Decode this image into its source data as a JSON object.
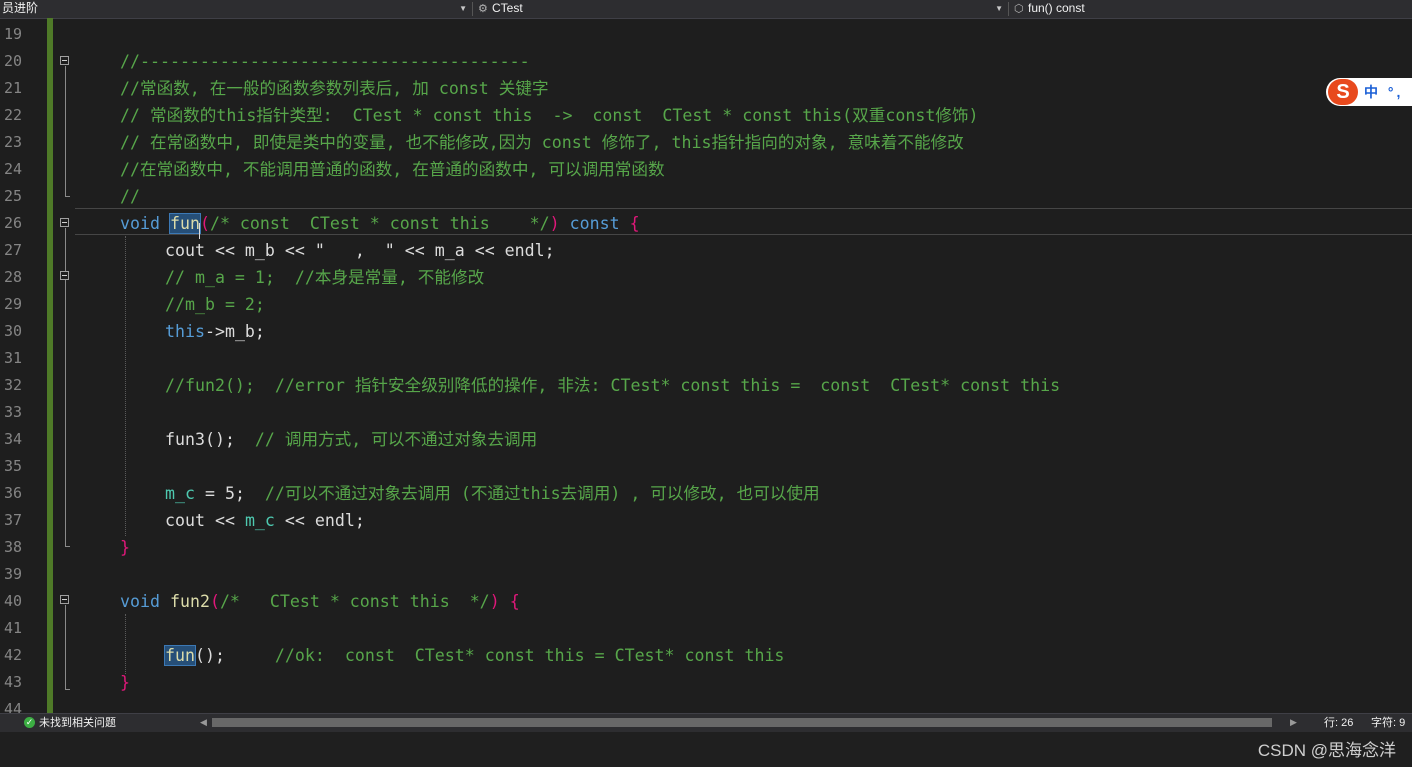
{
  "nav": {
    "project": "员进阶",
    "class_name": "CTest",
    "member": "fun() const"
  },
  "line_numbers": [
    "19",
    "20",
    "21",
    "22",
    "23",
    "24",
    "25",
    "26",
    "27",
    "28",
    "29",
    "30",
    "31",
    "32",
    "33",
    "34",
    "35",
    "36",
    "37",
    "38",
    "39",
    "40",
    "41",
    "42",
    "43",
    "44"
  ],
  "code": {
    "l20": "//---------------------------------------",
    "l21": "//常函数, 在一般的函数参数列表后, 加 const 关键字",
    "l22": "// 常函数的this指针类型:  CTest * const this  ->  const  CTest * const this(双重const修饰)",
    "l23": "// 在常函数中, 即使是类中的变量, 也不能修改,因为 const 修饰了, this指针指向的对象, 意味着不能修改",
    "l24": "//在常函数中, 不能调用普通的函数, 在普通的函数中, 可以调用常函数",
    "l25": "//",
    "l26_void": "void",
    "l26_fun": "fun",
    "l26_open": "(",
    "l26_comment": "/* const  CTest * const this    */",
    "l26_close": ")",
    "l26_const": "const",
    "l26_brace": "{",
    "l27": "cout << m_b << \"   ,  \" << m_a << endl;",
    "l28": "// m_a = 1;  //本身是常量, 不能修改",
    "l29": "//m_b = 2;",
    "l30_this": "this",
    "l30_rest": "->m_b;",
    "l32": "//fun2();  //error 指针安全级别降低的操作, 非法: CTest* const this =  const  CTest* const this",
    "l34_call": "fun3();",
    "l34_comment": "// 调用方式, 可以不通过对象去调用",
    "l36_var": "m_c",
    "l36_mid": " = 5;  ",
    "l36_comment": "//可以不通过对象去调用 (不通过this去调用) , 可以修改, 也可以使用",
    "l37_a": "cout << ",
    "l37_var": "m_c",
    "l37_b": " << endl;",
    "l38": "}",
    "l40_void": "void",
    "l40_fun": "fun2",
    "l40_open": "(",
    "l40_comment": "/*   CTest * const this  */",
    "l40_close": ")",
    "l40_brace": "{",
    "l42_fun": "fun",
    "l42_paren": "();",
    "l42_comment": "//ok:  const  CTest* const this = CTest* const this",
    "l43": "}"
  },
  "ime": {
    "logo": "S",
    "text": "中 °,"
  },
  "status": {
    "issues": "未找到相关问题",
    "line": "行: 26",
    "char": "字符: 9"
  },
  "watermark": "CSDN @思海念洋",
  "colors": {
    "background": "#1e1e1e",
    "comment": "#57a64a",
    "keyword": "#569cd6",
    "function": "#dcdcaa",
    "member": "#4ec9b0",
    "brace": "#e0187a",
    "change_bar": "#4f7a28"
  },
  "icons": [
    "class-icon",
    "method-icon",
    "fold-icon",
    "issue-ok-icon",
    "sogou-ime-icon"
  ]
}
